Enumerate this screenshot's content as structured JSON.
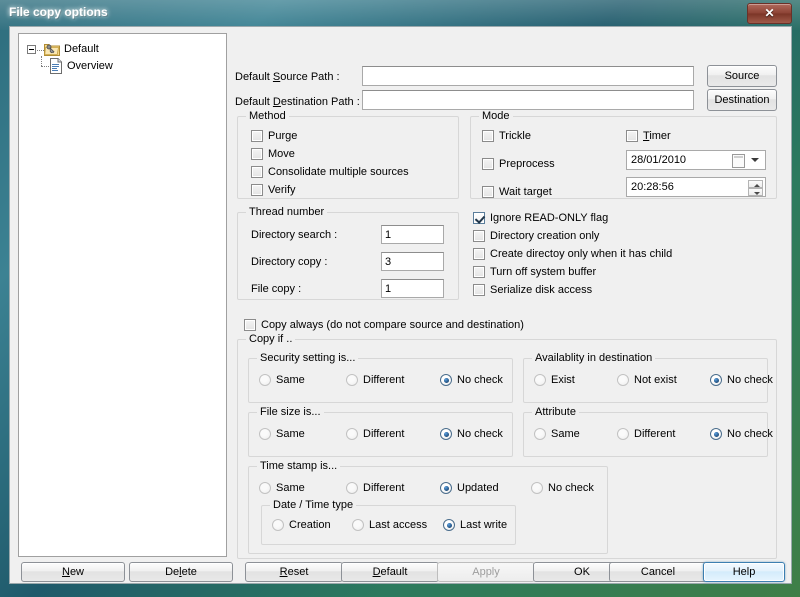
{
  "window": {
    "title": "File copy options",
    "close_label": "✕"
  },
  "tree": {
    "root": {
      "label": "Default",
      "icon": "folder-key-icon"
    },
    "child": {
      "label": "Overview",
      "icon": "document-icon"
    }
  },
  "paths": {
    "source_label": "Default Source Path :",
    "source_value": "",
    "source_button": "Source",
    "destination_label": "Default Destination Path :",
    "destination_value": "",
    "destination_button": "Destination"
  },
  "method": {
    "title": "Method",
    "items": [
      {
        "label": "Purge",
        "checked": false
      },
      {
        "label": "Move",
        "checked": false
      },
      {
        "label": "Consolidate multiple sources",
        "checked": false
      },
      {
        "label": "Verify",
        "checked": false
      }
    ]
  },
  "mode": {
    "title": "Mode",
    "items": [
      {
        "label": "Trickle",
        "checked": false
      },
      {
        "label": "Preprocess",
        "checked": false
      },
      {
        "label": "Wait target",
        "checked": false
      }
    ],
    "timer": {
      "label": "Timer",
      "checked": false
    },
    "date_value": "28/01/2010",
    "time_value": "20:28:56"
  },
  "thread": {
    "title": "Thread number",
    "rows": [
      {
        "label": "Directory search :",
        "value": "1"
      },
      {
        "label": "Directory copy :",
        "value": "3"
      },
      {
        "label": "File copy :",
        "value": "1"
      }
    ]
  },
  "options": {
    "items": [
      {
        "label": "Ignore READ-ONLY flag",
        "checked": true
      },
      {
        "label": "Directory creation only",
        "checked": false
      },
      {
        "label": "Create directoy only when it has child",
        "checked": false
      },
      {
        "label": "Turn off system buffer",
        "checked": false
      },
      {
        "label": "Serialize disk access",
        "checked": false
      }
    ]
  },
  "copy_always": {
    "label": "Copy always (do not compare source and destination)",
    "checked": false
  },
  "copy_if": {
    "title": "Copy if ..",
    "security": {
      "title": "Security setting is...",
      "options": [
        "Same",
        "Different",
        "No check"
      ],
      "selected": "No check"
    },
    "availability": {
      "title": "Availablity in destination",
      "options": [
        "Exist",
        "Not exist",
        "No check"
      ],
      "selected": "No check"
    },
    "filesize": {
      "title": "File size is...",
      "options": [
        "Same",
        "Different",
        "No check"
      ],
      "selected": "No check"
    },
    "attribute": {
      "title": "Attribute",
      "options": [
        "Same",
        "Different",
        "No check"
      ],
      "selected": "No check"
    },
    "timestamp": {
      "title": "Time stamp is...",
      "options": [
        "Same",
        "Different",
        "Updated",
        "No check"
      ],
      "selected": "Updated",
      "datetype": {
        "title": "Date / Time type",
        "options": [
          "Creation",
          "Last access",
          "Last write"
        ],
        "selected": "Last write"
      }
    }
  },
  "buttons": {
    "new": "New",
    "delete": "Delete",
    "reset": "Reset",
    "default": "Default",
    "apply": "Apply",
    "ok": "OK",
    "cancel": "Cancel",
    "help": "Help"
  }
}
